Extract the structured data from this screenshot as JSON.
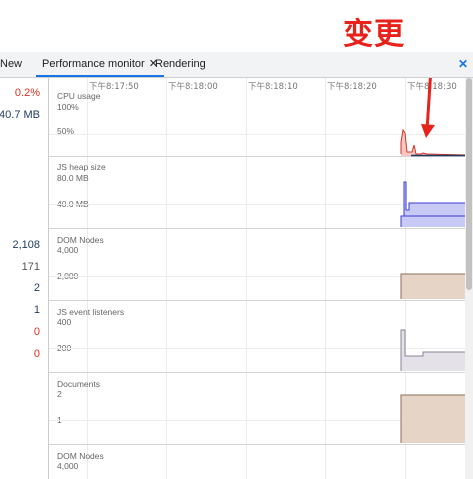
{
  "annotation": {
    "text": "变更"
  },
  "tabs": [
    {
      "label": "New"
    },
    {
      "label": "Performance monitor",
      "close": "✕"
    },
    {
      "label": "Rendering"
    }
  ],
  "panel_close": "✕",
  "metrics": [
    {
      "value": "0.2%"
    },
    {
      "value": "40.7 MB"
    },
    {
      "value": "2,108"
    },
    {
      "value": "171"
    },
    {
      "value": "2"
    },
    {
      "value": "1"
    },
    {
      "value": "0"
    },
    {
      "value": "0"
    }
  ],
  "time_labels": [
    "下午8:17:50",
    "下午8:18:00",
    "下午8:18:10",
    "下午8:18:20",
    "下午8:18:30"
  ],
  "charts": [
    {
      "title": "CPU usage",
      "scales": [
        "100%",
        "50%"
      ],
      "color": "#d93025",
      "fill": "#f4c7c3"
    },
    {
      "title": "JS heap size",
      "scales": [
        "80.0 MB",
        "40.0 MB"
      ],
      "color": "#3b3bd9",
      "fill": "#c9c9f5"
    },
    {
      "title": "DOM Nodes",
      "scales": [
        "4,000",
        "2,000"
      ],
      "color": "#8a6e5a",
      "fill": "#e6d5c6"
    },
    {
      "title": "JS event listeners",
      "scales": [
        "400",
        "200"
      ],
      "color": "#8a8494",
      "fill": "#e5e1e8"
    },
    {
      "title": "Documents",
      "scales": [
        "2",
        "1"
      ],
      "color": "#8a6e5a",
      "fill": "#e6d5c6"
    },
    {
      "title": "DOM Nodes",
      "scales": [
        "4,000"
      ],
      "color": "#8a6e5a",
      "fill": "#e6d5c6"
    }
  ]
}
